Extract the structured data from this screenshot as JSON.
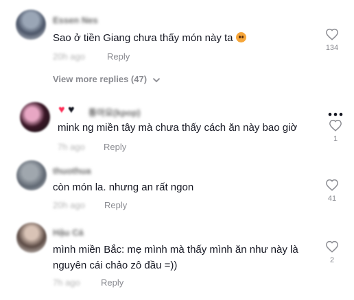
{
  "comments": [
    {
      "username": "Essen Nes",
      "text": "Sao ở tiền Giang chưa thấy món này ta",
      "emoji": "pleading-face-emoji",
      "time": "20h ago",
      "reply_label": "Reply",
      "likes": "134"
    },
    {
      "username": "틍아요(kpop)",
      "text": "mink ng miền tây mà chưa thấy cách ăn này bao giờ",
      "time": "7h ago",
      "reply_label": "Reply",
      "likes": "1"
    },
    {
      "username": "thuothua",
      "text": "còn món la. nhưng an rất ngon",
      "time": "20h ago",
      "reply_label": "Reply",
      "likes": "41"
    },
    {
      "username": "Hậu Cá",
      "text_line1": "mình miền Bắc: mẹ mình mà thấy mình ăn như này là",
      "text_line2": "nguyên cái chảo zô đầu =))",
      "time": "7h ago",
      "reply_label": "Reply",
      "likes": "2"
    }
  ],
  "view_more_replies": "View more replies (47)",
  "colors": {
    "heart_red": "#fe2c55",
    "muted_text": "#8a8b91",
    "primary_text": "#161823"
  },
  "icons": [
    "heart-outline-icon",
    "chevron-down-icon",
    "more-dots-icon"
  ]
}
